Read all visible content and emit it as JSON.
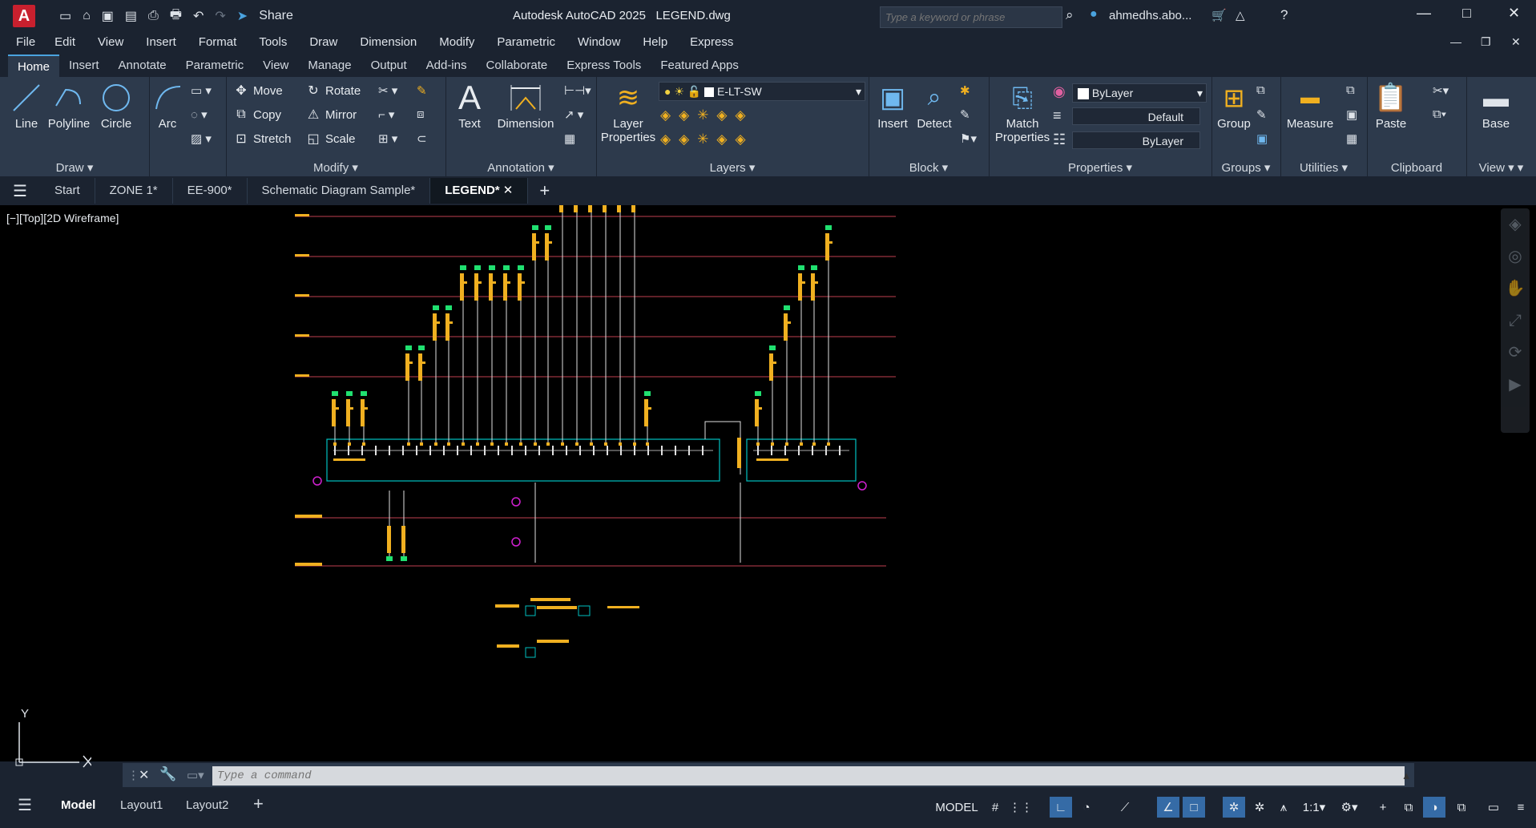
{
  "app": {
    "title": "Autodesk AutoCAD 2025",
    "filename": "LEGEND.dwg",
    "logo": "A",
    "share": "Share",
    "search_placeholder": "Type a keyword or phrase",
    "user": "ahmedhs.abo..."
  },
  "menu": [
    "File",
    "Edit",
    "View",
    "Insert",
    "Format",
    "Tools",
    "Draw",
    "Dimension",
    "Modify",
    "Parametric",
    "Window",
    "Help",
    "Express"
  ],
  "ribbon_tabs": [
    "Home",
    "Insert",
    "Annotate",
    "Parametric",
    "View",
    "Manage",
    "Output",
    "Add-ins",
    "Collaborate",
    "Express Tools",
    "Featured Apps"
  ],
  "ribbon": {
    "draw": {
      "title": "Draw",
      "line": "Line",
      "polyline": "Polyline",
      "circle": "Circle",
      "arc": "Arc"
    },
    "modify": {
      "title": "Modify",
      "move": "Move",
      "rotate": "Rotate",
      "copy": "Copy",
      "mirror": "Mirror",
      "stretch": "Stretch",
      "scale": "Scale"
    },
    "annotation": {
      "title": "Annotation",
      "text": "Text",
      "dimension": "Dimension"
    },
    "layers": {
      "title": "Layers",
      "layer_properties": "Layer Properties",
      "current_layer": "E-LT-SW"
    },
    "block": {
      "title": "Block",
      "insert": "Insert",
      "detect": "Detect"
    },
    "properties": {
      "title": "Properties",
      "match": "Match Properties",
      "color": "ByLayer",
      "lineweight": "Default",
      "linetype": "ByLayer"
    },
    "groups": {
      "title": "Groups",
      "group": "Group"
    },
    "utilities": {
      "title": "Utilities",
      "measure": "Measure"
    },
    "clipboard": {
      "title": "Clipboard",
      "paste": "Paste"
    },
    "view": {
      "title": "View",
      "base": "Base"
    }
  },
  "file_tabs": [
    "Start",
    "ZONE 1*",
    "EE-900*",
    "Schematic Diagram Sample*",
    "LEGEND*"
  ],
  "active_file_tab": "LEGEND*",
  "viewport_label": "[−][Top][2D Wireframe]",
  "ucs": {
    "y": "Y"
  },
  "command_placeholder": "Type a command",
  "layout_tabs": [
    "Model",
    "Layout1",
    "Layout2"
  ],
  "status": {
    "model": "MODEL",
    "scale": "1:1"
  },
  "colors": {
    "accent": "#4aa3df",
    "bus": "#00c0c0",
    "device": "#f0b020",
    "node": "#20e070",
    "floor": "#c04050",
    "marker": "#d020d0",
    "wire": "#e0e0e0"
  }
}
